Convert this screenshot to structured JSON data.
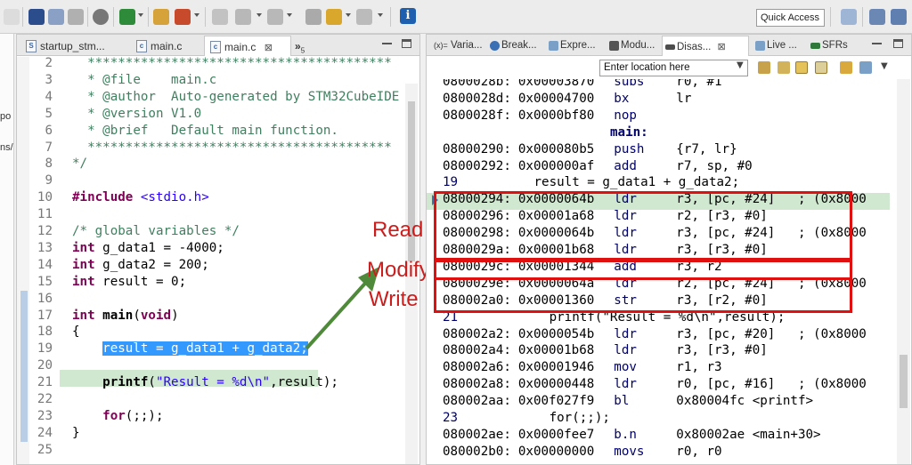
{
  "toolbar": {
    "quick_access_label": "Quick Access"
  },
  "left_sliver": {
    "fragments": [
      "po",
      "ns/"
    ]
  },
  "editor": {
    "tabs": [
      {
        "label": "startup_stm...",
        "icon": "S"
      },
      {
        "label": "main.c",
        "icon": "c"
      },
      {
        "label": "main.c",
        "icon": "c",
        "close": "⊠"
      },
      {
        "label": "»",
        "sub": "5"
      }
    ],
    "lines": [
      {
        "n": "2",
        "html": "<span class=\"cm\">  ****************************************</span>"
      },
      {
        "n": "3",
        "html": "<span class=\"cm\">  * @file    main.c</span>"
      },
      {
        "n": "4",
        "html": "<span class=\"cm\">  * @author  Auto-generated by STM32CubeIDE</span>"
      },
      {
        "n": "5",
        "html": "<span class=\"cm\">  * @version V1.0</span>"
      },
      {
        "n": "6",
        "html": "<span class=\"cm\">  * @brief   Default main function.</span>"
      },
      {
        "n": "7",
        "html": "<span class=\"cm\">  ****************************************</span>"
      },
      {
        "n": "8",
        "html": "<span class=\"cm\">*/</span>"
      },
      {
        "n": "9",
        "html": ""
      },
      {
        "n": "10",
        "html": "<span class=\"kw\">#include</span> <span class=\"inc\">&lt;stdio.h&gt;</span>"
      },
      {
        "n": "11",
        "html": ""
      },
      {
        "n": "12",
        "html": "<span class=\"cm\">/* global variables */</span>"
      },
      {
        "n": "13",
        "html": "<span class=\"kw\">int</span> g_data1 = -4000;"
      },
      {
        "n": "14",
        "html": "<span class=\"kw\">int</span> g_data2 = 200;"
      },
      {
        "n": "15",
        "html": "<span class=\"kw\">int</span> result = 0;"
      },
      {
        "n": "16",
        "html": ""
      },
      {
        "n": "17",
        "html": "<span class=\"kw\">int</span> <span class=\"fn\">main</span>(<span class=\"kw\">void</span>)"
      },
      {
        "n": "18",
        "html": "{"
      },
      {
        "n": "19",
        "html": "    <span class=\"sel\">result = g_data1 + g_data2;</span>"
      },
      {
        "n": "20",
        "html": ""
      },
      {
        "n": "21",
        "html": "    <span class=\"fn\">printf</span>(<span class=\"str\">\"Result = %d\\n\"</span>,result);"
      },
      {
        "n": "22",
        "html": ""
      },
      {
        "n": "23",
        "html": "    <span class=\"kw\">for</span>(;;);"
      },
      {
        "n": "24",
        "html": "}"
      },
      {
        "n": "25",
        "html": ""
      }
    ]
  },
  "annotations": {
    "read": "Read",
    "modify": "Modify",
    "write": "Write"
  },
  "views": {
    "tabs": [
      {
        "label": "Varia...",
        "prefix": "(x)="
      },
      {
        "label": "Break...",
        "prefix": ""
      },
      {
        "label": "Expre...",
        "prefix": ""
      },
      {
        "label": "Modu...",
        "prefix": ""
      },
      {
        "label": "Disas...",
        "prefix": "",
        "close": "⊠"
      },
      {
        "label": "Live ...",
        "prefix": ""
      },
      {
        "label": "SFRs",
        "prefix": ""
      }
    ],
    "location_placeholder": "Enter location here"
  },
  "disassembly": [
    {
      "addr": "0800028b:",
      "op": "0x00003870",
      "mn": "subs",
      "args": "r0, #1"
    },
    {
      "addr": "0800028d:",
      "op": "0x00004700",
      "mn": "bx",
      "args": "lr"
    },
    {
      "addr": "0800028f:",
      "op": "0x0000bf80",
      "mn": "nop",
      "args": ""
    },
    {
      "label": "main:"
    },
    {
      "addr": "08000290:",
      "op": "0x000080b5",
      "mn": "push",
      "args": "{r7, lr}"
    },
    {
      "addr": "08000292:",
      "op": "0x000000af",
      "mn": "add",
      "args": "r7, sp, #0"
    },
    {
      "src": "19",
      "text": "          result = g_data1 + g_data2;"
    },
    {
      "addr": "08000294:",
      "op": "0x0000064b",
      "mn": "ldr",
      "args": "r3, [pc, #24]   ; (0x8000"
    },
    {
      "addr": "08000296:",
      "op": "0x00001a68",
      "mn": "ldr",
      "args": "r2, [r3, #0]"
    },
    {
      "addr": "08000298:",
      "op": "0x0000064b",
      "mn": "ldr",
      "args": "r3, [pc, #24]   ; (0x8000"
    },
    {
      "addr": "0800029a:",
      "op": "0x00001b68",
      "mn": "ldr",
      "args": "r3, [r3, #0]"
    },
    {
      "addr": "0800029c:",
      "op": "0x00001344",
      "mn": "add",
      "args": "r3, r2"
    },
    {
      "addr": "0800029e:",
      "op": "0x0000064a",
      "mn": "ldr",
      "args": "r2, [pc, #24]   ; (0x8000"
    },
    {
      "addr": "080002a0:",
      "op": "0x00001360",
      "mn": "str",
      "args": "r3, [r2, #0]"
    },
    {
      "src": "21",
      "text": "            printf(\"Result = %d\\n\",result);"
    },
    {
      "addr": "080002a2:",
      "op": "0x0000054b",
      "mn": "ldr",
      "args": "r3, [pc, #20]   ; (0x8000"
    },
    {
      "addr": "080002a4:",
      "op": "0x00001b68",
      "mn": "ldr",
      "args": "r3, [r3, #0]"
    },
    {
      "addr": "080002a6:",
      "op": "0x00001946",
      "mn": "mov",
      "args": "r1, r3"
    },
    {
      "addr": "080002a8:",
      "op": "0x00000448",
      "mn": "ldr",
      "args": "r0, [pc, #16]   ; (0x8000"
    },
    {
      "addr": "080002aa:",
      "op": "0x00f027f9",
      "mn": "bl",
      "args": "0x80004fc <printf>"
    },
    {
      "src": "23",
      "text": "            for(;;);"
    },
    {
      "addr": "080002ae:",
      "op": "0x0000fee7",
      "mn": "b.n",
      "args": "0x80002ae <main+30>"
    },
    {
      "addr": "080002b0:",
      "op": "0x00000000",
      "mn": "movs",
      "args": "r0, r0"
    }
  ],
  "colors": {
    "annotation_red": "#cc1d1d",
    "highlight_green": "#cfe8cf",
    "selection_blue": "#3399ff",
    "arrow_green": "#4f8a3a"
  }
}
